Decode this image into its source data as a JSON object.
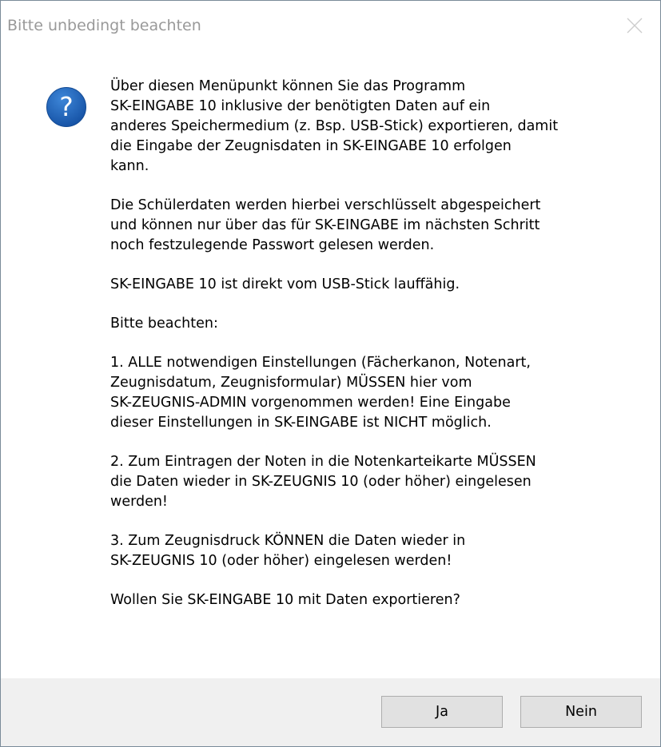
{
  "dialog": {
    "title": "Bitte unbedingt beachten",
    "icon": "question-icon",
    "paragraphs": [
      "Über diesen Menüpunkt können Sie das Programm\nSK-EINGABE 10 inklusive der benötigten Daten auf ein\nanderes Speichermedium (z. Bsp. USB-Stick) exportieren, damit\ndie Eingabe der Zeugnisdaten in SK-EINGABE 10 erfolgen\nkann.",
      "Die Schülerdaten werden hierbei verschlüsselt abgespeichert\nund können nur über das für SK-EINGABE im nächsten Schritt\nnoch festzulegende Passwort gelesen werden.",
      "SK-EINGABE 10 ist direkt vom USB-Stick lauffähig.",
      "Bitte beachten:",
      "1. ALLE notwendigen Einstellungen (Fächerkanon, Notenart,\nZeugnisdatum, Zeugnisformular) MÜSSEN hier vom\nSK-ZEUGNIS-ADMIN vorgenommen werden! Eine Eingabe\ndieser Einstellungen in SK-EINGABE ist NICHT möglich.",
      "2. Zum Eintragen der Noten in die Notenkarteikarte MÜSSEN\ndie Daten wieder in SK-ZEUGNIS 10 (oder höher) eingelesen\nwerden!",
      "3. Zum Zeugnisdruck KÖNNEN die Daten wieder in\nSK-ZEUGNIS 10 (oder höher) eingelesen werden!",
      "Wollen Sie SK-EINGABE 10 mit Daten exportieren?"
    ],
    "buttons": {
      "yes_label": "Ja",
      "no_label": "Nein"
    },
    "colors": {
      "icon_blue": "#1f5fb0",
      "footer_bg": "#f0f0f0",
      "title_text": "#999999"
    }
  }
}
